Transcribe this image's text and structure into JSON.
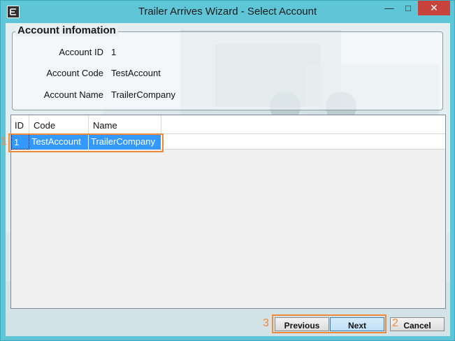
{
  "window": {
    "title": "Trailer Arrives Wizard - Select Account",
    "close_glyph": "✕",
    "maximize_glyph": "□",
    "minimize_glyph": "—",
    "icon": "app-icon"
  },
  "account_info": {
    "title": "Account infomation",
    "fields": [
      {
        "label": "Account ID",
        "value": "1"
      },
      {
        "label": "Account Code",
        "value": "TestAccount"
      },
      {
        "label": "Account Name",
        "value": "TrailerCompany"
      }
    ]
  },
  "grid": {
    "columns": [
      "ID",
      "Code",
      "Name"
    ],
    "rows": [
      {
        "id": "1",
        "code": "TestAccount",
        "name": "TrailerCompany",
        "selected": true
      }
    ]
  },
  "buttons": {
    "previous": "Previous",
    "next": "Next",
    "cancel": "Cancel"
  },
  "markers": [
    "1",
    "2",
    "3"
  ],
  "colors": {
    "frame": "#5fc6d8",
    "highlight": "#f08a3a",
    "selection": "#3399ff",
    "close": "#c7433b"
  }
}
